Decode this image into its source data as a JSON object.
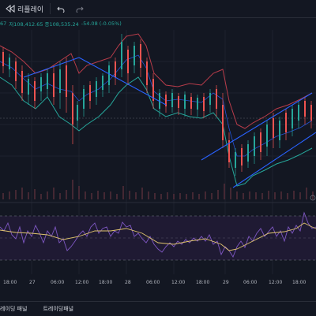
{
  "toolbar": {
    "replay_label": "리플레이",
    "undo_icon": "undo-icon",
    "redo_icon": "redo-icon",
    "replay_icon": "rewind-icon"
  },
  "legend": {
    "prefix": "67",
    "value_label": "저108,412.65 종108,535.24",
    "change": "-54.08 (-0.05%)"
  },
  "x_axis": {
    "labels": [
      "18:00",
      "27",
      "06:00",
      "12:00",
      "18:00",
      "28",
      "06:00",
      "12:00",
      "18:00",
      "29",
      "06:00",
      "12:00",
      "18:00"
    ]
  },
  "bottom_tabs": {
    "tab1": "레이딩 패널",
    "tab2": "트레이딩패널"
  },
  "colors": {
    "background": "#131722",
    "up": "#26a69a",
    "down": "#ef5350",
    "bollinger": "#b83c4a",
    "rsi": "#7e57c2",
    "trendline": "#2962ff"
  }
}
